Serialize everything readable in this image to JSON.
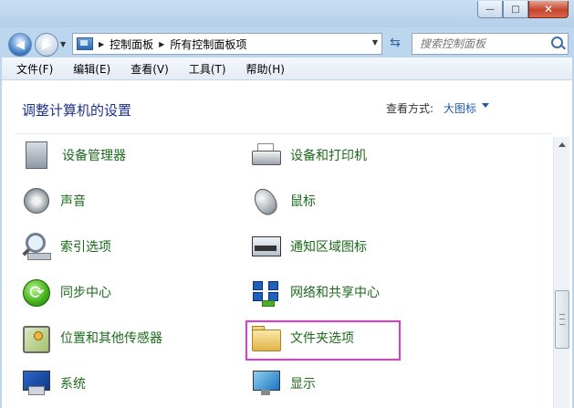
{
  "window": {
    "buttons": {
      "minimize": "—",
      "maximize": "□",
      "close": "✕"
    }
  },
  "nav": {
    "back_glyph": "◀",
    "forward_glyph": "▶",
    "dropdown_glyph": "▼",
    "breadcrumb": [
      "控制面板",
      "所有控制面板项"
    ],
    "refresh_glyph": "⇆",
    "search_placeholder": "搜索控制面板"
  },
  "menu": [
    "文件(F)",
    "编辑(E)",
    "查看(V)",
    "工具(T)",
    "帮助(H)"
  ],
  "content": {
    "title": "调整计算机的设置",
    "view_by_label": "查看方式:",
    "view_by_value": "大图标"
  },
  "items": [
    {
      "label": "设备管理器",
      "icon": "device-manager-icon"
    },
    {
      "label": "设备和打印机",
      "icon": "printer-icon"
    },
    {
      "label": "声音",
      "icon": "speaker-icon"
    },
    {
      "label": "鼠标",
      "icon": "mouse-icon"
    },
    {
      "label": "索引选项",
      "icon": "indexing-icon"
    },
    {
      "label": "通知区域图标",
      "icon": "notification-icon"
    },
    {
      "label": "同步中心",
      "icon": "sync-icon"
    },
    {
      "label": "网络和共享中心",
      "icon": "network-icon"
    },
    {
      "label": "位置和其他传感器",
      "icon": "location-sensor-icon"
    },
    {
      "label": "文件夹选项",
      "icon": "folder-icon"
    },
    {
      "label": "系统",
      "icon": "system-icon"
    },
    {
      "label": "显示",
      "icon": "display-icon"
    }
  ],
  "highlight_color": "#e03ad6"
}
